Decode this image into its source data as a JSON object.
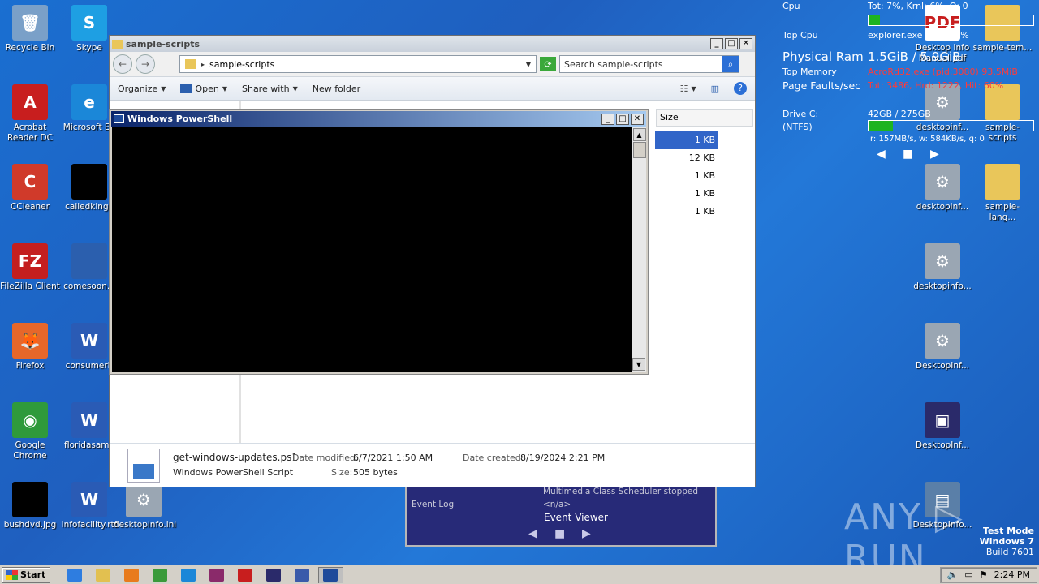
{
  "desktop": {
    "icons": [
      {
        "name": "recycle-bin",
        "label": "Recycle Bin",
        "color": "#7aa0c8",
        "glyph": "🗑"
      },
      {
        "name": "skype",
        "label": "Skype",
        "color": "#1e9fe3",
        "glyph": "S"
      },
      {
        "name": "acrobat",
        "label": "Acrobat Reader DC",
        "color": "#c81e1e",
        "glyph": "A"
      },
      {
        "name": "edge",
        "label": "Microsoft Ed",
        "color": "#1b87d8",
        "glyph": "e"
      },
      {
        "name": "ccleaner",
        "label": "CCleaner",
        "color": "#d03a2a",
        "glyph": "C"
      },
      {
        "name": "calledking",
        "label": "calledking.j",
        "color": "#000000",
        "glyph": ""
      },
      {
        "name": "filezilla",
        "label": "FileZilla Client",
        "color": "#c41f1f",
        "glyph": "FZ"
      },
      {
        "name": "comesoon",
        "label": "comesoon.p",
        "color": "#2b5fae",
        "glyph": ""
      },
      {
        "name": "firefox",
        "label": "Firefox",
        "color": "#e6672a",
        "glyph": "🦊"
      },
      {
        "name": "consumerb",
        "label": "consumerb",
        "color": "#2a5bb5",
        "glyph": "W"
      },
      {
        "name": "chrome",
        "label": "Google Chrome",
        "color": "#2f9a3b",
        "glyph": "◉"
      },
      {
        "name": "floridasame",
        "label": "floridasame",
        "color": "#2a5bb5",
        "glyph": "W"
      },
      {
        "name": "bushdvd",
        "label": "bushdvd.jpg",
        "color": "#000000",
        "glyph": ""
      },
      {
        "name": "infofacility",
        "label": "infofacility.rtf",
        "color": "#2a5bb5",
        "glyph": "W"
      },
      {
        "name": "desktopinfo-ini",
        "label": "desktopinfo.ini",
        "color": "#9aa6b3",
        "glyph": "⚙"
      },
      {
        "name": "desktop-info-manual",
        "label": "Desktop Info Manual.pdf",
        "color": "#ffffff",
        "glyph": "PDF"
      },
      {
        "name": "sample-tem",
        "label": "sample-tem...",
        "color": "#e9c65a",
        "glyph": ""
      },
      {
        "name": "desktopinf-1",
        "label": "desktopinf...",
        "color": "#9aa6b3",
        "glyph": "⚙"
      },
      {
        "name": "sample-scripts",
        "label": "sample-scripts",
        "color": "#e9c65a",
        "glyph": ""
      },
      {
        "name": "desktopinf-2",
        "label": "desktopinf...",
        "color": "#9aa6b3",
        "glyph": "⚙"
      },
      {
        "name": "sample-lang",
        "label": "sample-lang...",
        "color": "#e9c65a",
        "glyph": ""
      },
      {
        "name": "desktopinfo-3",
        "label": "desktopinfo...",
        "color": "#9aa6b3",
        "glyph": "⚙"
      },
      {
        "name": "desktopinf-4",
        "label": "DesktopInf...",
        "color": "#9aa6b3",
        "glyph": "⚙"
      },
      {
        "name": "desktopinf-5",
        "label": "DesktopInf...",
        "color": "#2a2a6a",
        "glyph": "▣"
      },
      {
        "name": "desktopinfo-6",
        "label": "DesktopInfo...",
        "color": "#5a7fa8",
        "glyph": "▤"
      }
    ]
  },
  "sysinfo": {
    "cpu_label": "Cpu",
    "cpu_value": "Tot:  7%, Krnl:  6%, Q: 0",
    "top_cpu_label": "Top Cpu",
    "top_cpu_value": "explorer.exe (pid:   ) 1%",
    "ram_label": "Physical Ram",
    "ram_value": "1.5GiB / 5.9GiB",
    "top_mem_label": "Top Memory",
    "top_mem_value": "AcroRd32.exe (pid:3080) 93.5MiB",
    "faults_label": "Page Faults/sec",
    "faults_value": "Tot: 3486, Hrd: 1222, Hit: 60%",
    "drive_label": "Drive C:",
    "drive_fs": "(NTFS)",
    "drive_value": "42GB / 275GB",
    "drive_rate": "r: 157MB/s, w: 584KB/s, q: 0",
    "cpu_pct": 0.07,
    "drive_pct": 0.15
  },
  "eventlog": {
    "label": "Event Log",
    "message": "Multimedia Class Scheduler stopped",
    "na": "<n/a>",
    "viewer": "Event Viewer"
  },
  "watermark": {
    "brand": "ANY ▷ RUN",
    "mode1": "Test Mode",
    "mode2": "Windows 7",
    "mode3": "Build 7601"
  },
  "explorer": {
    "title": "sample-scripts",
    "address": "sample-scripts",
    "search_placeholder": "Search sample-scripts",
    "toolbar": {
      "organize": "Organize",
      "open": "Open",
      "share": "Share with",
      "new_folder": "New folder"
    },
    "column_size": "Size",
    "sizes": [
      "1 KB",
      "12 KB",
      "1 KB",
      "1 KB",
      "1 KB"
    ],
    "details": {
      "filename": "get-windows-updates.ps1",
      "type": "Windows PowerShell Script",
      "modified_label": "Date modified:",
      "modified": "6/7/2021 1:50 AM",
      "created_label": "Date created:",
      "created": "8/19/2024 2:21 PM",
      "size_label": "Size:",
      "size": "505 bytes"
    }
  },
  "powershell": {
    "title": "Windows PowerShell"
  },
  "taskbar": {
    "start": "Start",
    "clock": "2:24 PM",
    "apps": [
      {
        "name": "ie",
        "color": "#2e7de0"
      },
      {
        "name": "explorer",
        "color": "#e2c050"
      },
      {
        "name": "media",
        "color": "#e87b1c"
      },
      {
        "name": "chrome",
        "color": "#3a9a3a"
      },
      {
        "name": "edge",
        "color": "#1b87d8"
      },
      {
        "name": "winrar",
        "color": "#8a2a6a"
      },
      {
        "name": "acrobat",
        "color": "#c81e1e"
      },
      {
        "name": "desktopinfo",
        "color": "#2a2a6a"
      },
      {
        "name": "tool",
        "color": "#3a5aaa"
      },
      {
        "name": "powershell",
        "color": "#1e4a9a"
      }
    ]
  }
}
